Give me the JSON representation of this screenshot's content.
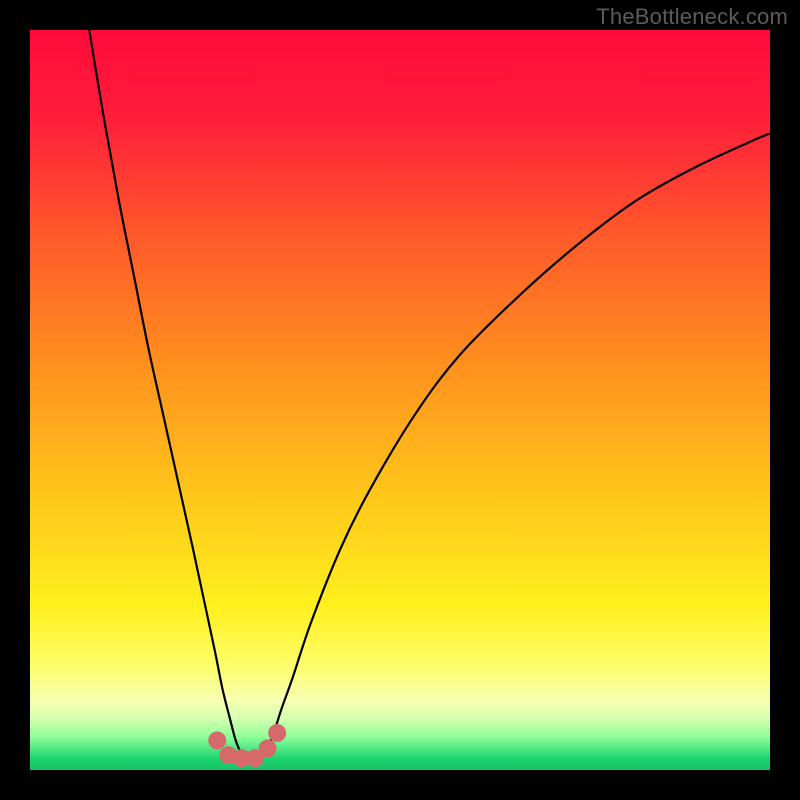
{
  "watermark": "TheBottleneck.com",
  "chart_data": {
    "type": "line",
    "title": "",
    "xlabel": "",
    "ylabel": "",
    "xlim": [
      0,
      100
    ],
    "ylim": [
      0,
      100
    ],
    "grid": false,
    "legend": false,
    "background_gradient": {
      "orientation": "vertical",
      "stops": [
        {
          "offset": 0.0,
          "color": "#ff0a3b"
        },
        {
          "offset": 0.12,
          "color": "#ff1e3a"
        },
        {
          "offset": 0.28,
          "color": "#ff5a2a"
        },
        {
          "offset": 0.45,
          "color": "#ff8f1e"
        },
        {
          "offset": 0.62,
          "color": "#ffc41a"
        },
        {
          "offset": 0.78,
          "color": "#fff01e"
        },
        {
          "offset": 0.86,
          "color": "#fdfe6a"
        },
        {
          "offset": 0.905,
          "color": "#f7ffb0"
        },
        {
          "offset": 0.93,
          "color": "#d6ffb0"
        },
        {
          "offset": 0.955,
          "color": "#8fff9a"
        },
        {
          "offset": 0.985,
          "color": "#1bd36f"
        },
        {
          "offset": 1.0,
          "color": "#18c268"
        }
      ]
    },
    "series": [
      {
        "name": "bottleneck-curve",
        "type": "line",
        "color": "#000000",
        "x": [
          8,
          10,
          12,
          14,
          16,
          18,
          20,
          22,
          23.5,
          25,
          26,
          27,
          27.8,
          28.5,
          29.5,
          31,
          32,
          33,
          34,
          35.5,
          38,
          42,
          46,
          52,
          58,
          66,
          74,
          82,
          90,
          98,
          100
        ],
        "y": [
          100,
          88,
          77,
          67,
          57,
          48,
          39,
          30,
          23,
          16,
          11,
          7,
          4,
          2.4,
          1.6,
          1.6,
          2.8,
          5.2,
          8.3,
          12.5,
          20,
          30,
          38,
          48,
          56,
          64,
          71,
          77,
          81.5,
          85.2,
          86
        ]
      },
      {
        "name": "trough-markers",
        "type": "scatter",
        "color": "#d66a6a",
        "marker_size": 9,
        "x": [
          25.3,
          26.8,
          28.6,
          30.4,
          32.1,
          33.4
        ],
        "y": [
          4.0,
          2.0,
          1.6,
          1.6,
          2.9,
          5.0
        ]
      }
    ],
    "annotations": []
  }
}
